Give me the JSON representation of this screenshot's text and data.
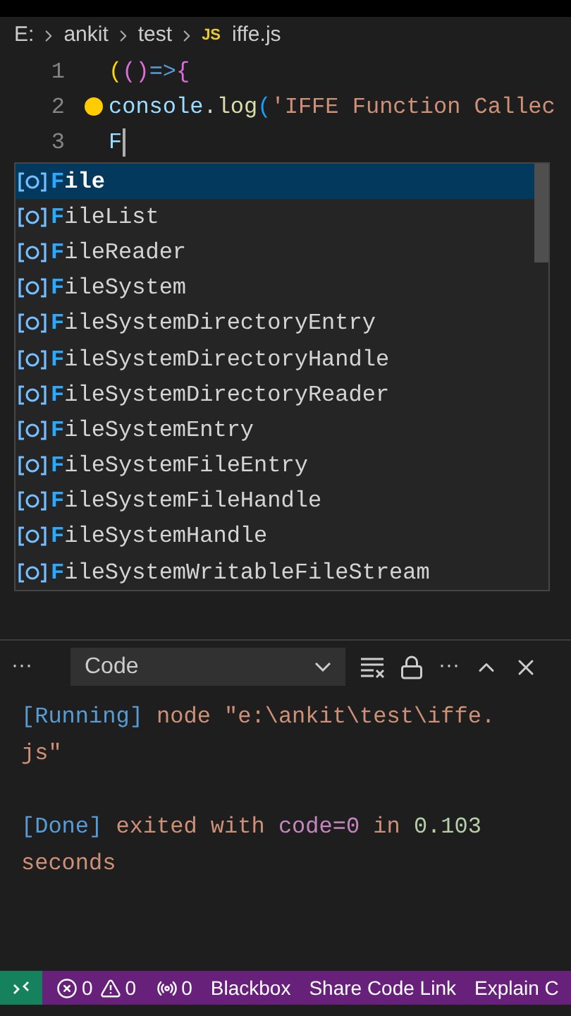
{
  "breadcrumbs": [
    {
      "label": "E:"
    },
    {
      "label": "ankit"
    },
    {
      "label": "test"
    },
    {
      "label": "iffe.js",
      "badge": "JS"
    }
  ],
  "code_lines": [
    {
      "number": "1",
      "tokens": [
        {
          "text": "(",
          "color": "#ffd700"
        },
        {
          "text": "(",
          "color": "#da70d6"
        },
        {
          "text": ")",
          "color": "#da70d6"
        },
        {
          "text": "=>",
          "color": "#569cd6"
        },
        {
          "text": "{",
          "color": "#da70d6"
        }
      ]
    },
    {
      "number": "2",
      "tokens": [
        {
          "text": "console",
          "color": "#9cdcfe"
        },
        {
          "text": ".",
          "color": "#d4d4d4"
        },
        {
          "text": "log",
          "color": "#dcdcaa"
        },
        {
          "text": "(",
          "color": "#179fff"
        },
        {
          "text": "'IFFE Function Callec",
          "color": "#ce9178"
        }
      ]
    },
    {
      "number": "3",
      "tokens": [
        {
          "text": "F",
          "color": "#9cdcfe"
        }
      ]
    }
  ],
  "suggestions": [
    {
      "match": "F",
      "rest": "ile",
      "selected": true
    },
    {
      "match": "F",
      "rest": "ileList",
      "selected": false
    },
    {
      "match": "F",
      "rest": "ileReader",
      "selected": false
    },
    {
      "match": "F",
      "rest": "ileSystem",
      "selected": false
    },
    {
      "match": "F",
      "rest": "ileSystemDirectoryEntry",
      "selected": false
    },
    {
      "match": "F",
      "rest": "ileSystemDirectoryHandle",
      "selected": false
    },
    {
      "match": "F",
      "rest": "ileSystemDirectoryReader",
      "selected": false
    },
    {
      "match": "F",
      "rest": "ileSystemEntry",
      "selected": false
    },
    {
      "match": "F",
      "rest": "ileSystemFileEntry",
      "selected": false
    },
    {
      "match": "F",
      "rest": "ileSystemFileHandle",
      "selected": false
    },
    {
      "match": "F",
      "rest": "ileSystemHandle",
      "selected": false
    },
    {
      "match": "F",
      "rest": "ileSystemWritableFileStream",
      "selected": false
    }
  ],
  "panel": {
    "more": "···",
    "channel": "Code",
    "more_actions": "···"
  },
  "output": [
    {
      "tokens": [
        {
          "text": "[Running]",
          "color": "#569cd6"
        },
        {
          "text": " node \"e:\\ankit\\test\\iffe.js\"",
          "color": "#ce9178"
        }
      ]
    },
    {
      "tokens": [
        {
          "text": "[Done]",
          "color": "#569cd6"
        },
        {
          "text": " exited with ",
          "color": "#ce9178"
        },
        {
          "text": "code=0",
          "color": "#c586c0"
        },
        {
          "text": " in ",
          "color": "#ce9178"
        },
        {
          "text": "0.103",
          "color": "#b5cea8"
        },
        {
          "text": " seconds",
          "color": "#ce9178"
        }
      ]
    }
  ],
  "status_bar": {
    "errors": "0",
    "warnings": "0",
    "ports": "0",
    "items": [
      "Blackbox",
      "Share Code Link",
      "Explain C"
    ]
  }
}
